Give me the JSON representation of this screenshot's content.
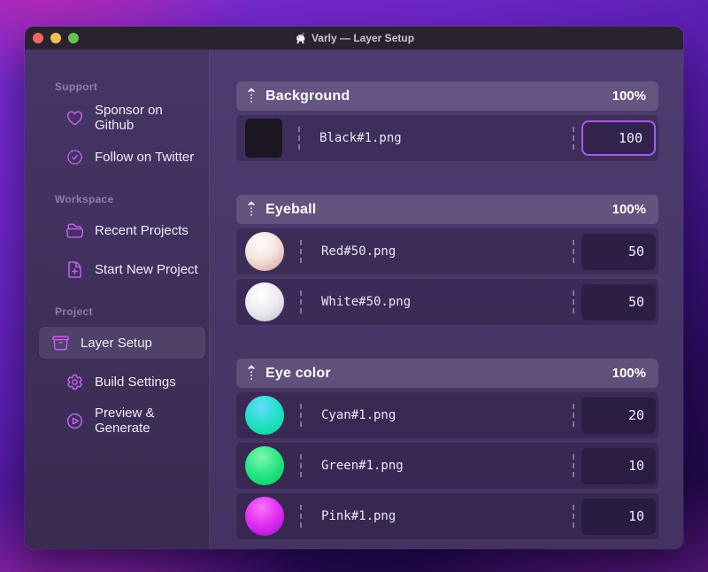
{
  "window": {
    "title": "Varly — Layer Setup",
    "app_icon": "unicorn-icon"
  },
  "titlebar": {
    "traffic_lights": [
      "close",
      "minimize",
      "zoom"
    ]
  },
  "sidebar": {
    "sections": [
      {
        "label": "Support",
        "items": [
          {
            "icon": "heart-icon",
            "label": "Sponsor on Github"
          },
          {
            "icon": "check-badge-icon",
            "label": "Follow on Twitter"
          }
        ]
      },
      {
        "label": "Workspace",
        "items": [
          {
            "icon": "folder-open-icon",
            "label": "Recent Projects"
          },
          {
            "icon": "document-plus-icon",
            "label": "Start New Project"
          }
        ]
      },
      {
        "label": "Project",
        "items": [
          {
            "icon": "archive-box-icon",
            "label": "Layer Setup",
            "active": true
          },
          {
            "icon": "gear-icon",
            "label": "Build Settings"
          },
          {
            "icon": "play-circle-icon",
            "label": "Preview & Generate"
          }
        ]
      }
    ]
  },
  "layers": {
    "groups": [
      {
        "name": "Background",
        "weight": "100%",
        "items": [
          {
            "thumb": "black-square",
            "file": "Black#1.png",
            "value": "100",
            "focused": true
          }
        ]
      },
      {
        "name": "Eyeball",
        "weight": "100%",
        "items": [
          {
            "thumb": "red-sphere",
            "file": "Red#50.png",
            "value": "50"
          },
          {
            "thumb": "white-sphere",
            "file": "White#50.png",
            "value": "50"
          }
        ]
      },
      {
        "name": "Eye color",
        "weight": "100%",
        "items": [
          {
            "thumb": "cyan-sphere",
            "file": "Cyan#1.png",
            "value": "20"
          },
          {
            "thumb": "green-sphere",
            "file": "Green#1.png",
            "value": "10"
          },
          {
            "thumb": "pink-sphere",
            "file": "Pink#1.png",
            "value": "10"
          }
        ]
      }
    ]
  },
  "colors": {
    "accent_purple": "#a958f0",
    "icon_purple": "#c75ef2",
    "titlebar_bg": "#29232f",
    "sidebar_bg": "#463566",
    "content_bg": "#4e3c70",
    "wallpaper_violet": "#6d26c7",
    "wallpaper_magenta": "#c72dbe"
  }
}
